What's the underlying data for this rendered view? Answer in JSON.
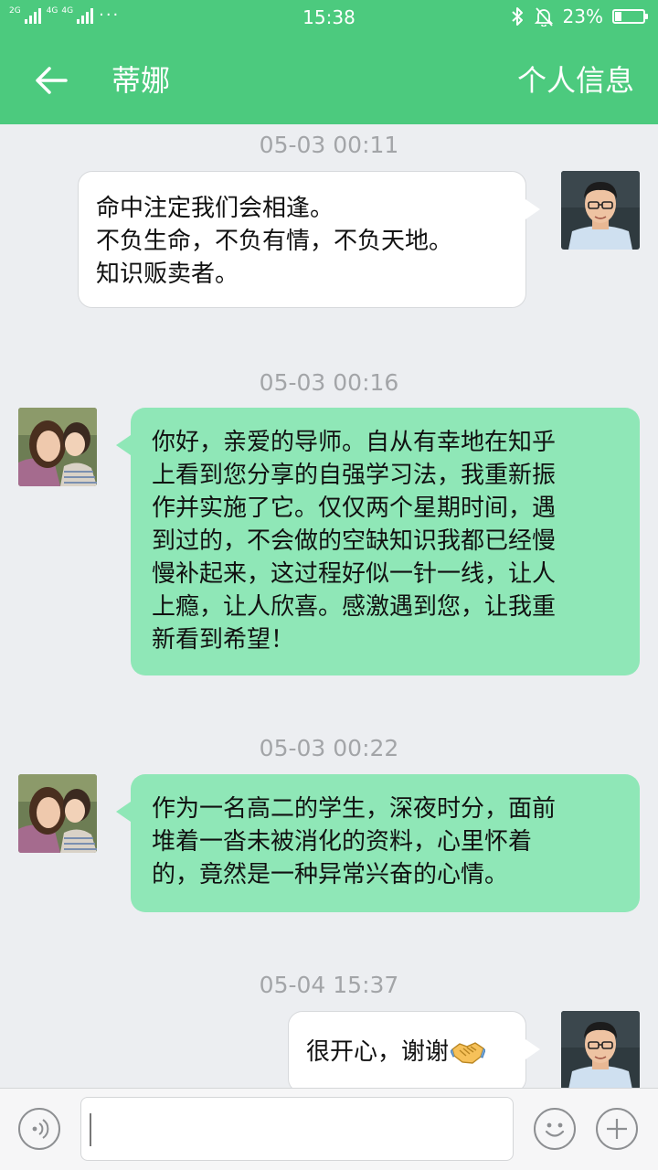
{
  "status_bar": {
    "sim1_tag": "2G",
    "sim2_tag": "4G",
    "sim3_tag": "4G",
    "more": "···",
    "time": "15:38",
    "battery_text": "23%",
    "battery_level": 0.23
  },
  "header": {
    "title": "蒂娜",
    "profile_label": "个人信息"
  },
  "messages": [
    {
      "timestamp": "05-03 00:11",
      "sender": "self",
      "text": "命中注定我们会相逢。\n不负生命，不负有情，不负天地。\n知识贩卖者。"
    },
    {
      "timestamp": "05-03 00:16",
      "sender": "contact",
      "text": "你好，亲爱的导师。自从有幸地在知乎\n上看到您分享的自强学习法，我重新振\n作并实施了它。仅仅两个星期时间，遇\n到过的，不会做的空缺知识我都已经慢\n慢补起来，这过程好似一针一线，让人\n上瘾，让人欣喜。感激遇到您，让我重\n新看到希望！"
    },
    {
      "timestamp": "05-03 00:22",
      "sender": "contact",
      "text": "作为一名高二的学生，深夜时分，面前\n堆着一沓未被消化的资料，心里怀着\n的，竟然是一种异常兴奋的心情。"
    },
    {
      "timestamp": "05-04 15:37",
      "sender": "self",
      "text": "很开心，谢谢",
      "emoji": "handshake-icon"
    }
  ],
  "input_bar": {
    "text_value": ""
  },
  "colors": {
    "brand_green": "#4cca7e",
    "bubble_green": "#8fe7b7",
    "background": "#eceef1"
  }
}
